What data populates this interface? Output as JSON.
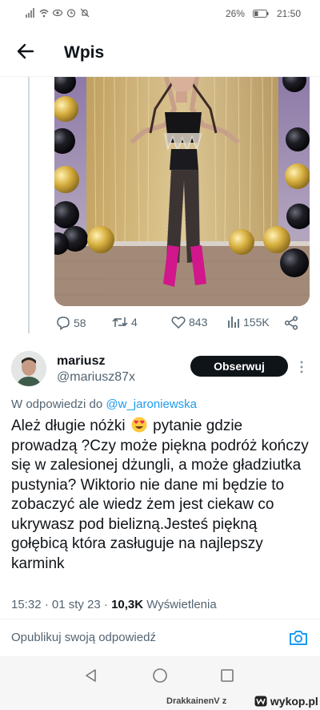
{
  "status_bar": {
    "battery": "26%",
    "time": "21:50"
  },
  "header": {
    "title": "Wpis"
  },
  "parent_tweet": {
    "media_alt_icon": "photo",
    "stats": {
      "replies": "58",
      "retweets": "4",
      "likes": "843",
      "views": "155K"
    }
  },
  "reply": {
    "author_name": "mariusz",
    "author_handle": "@mariusz87x",
    "follow_label": "Obserwuj",
    "reply_to_prefix": "W odpowiedzi do",
    "reply_to_handle": "@w_jaroniewska",
    "text_before_emoji": "Ależ długie nóżki",
    "text_after_emoji": "pytanie gdzie prowadzą ?Czy może piękna podróż kończy się w zalesionej dżungli, a może gładziutka pustynia? Wiktorio nie dane mi będzie to zobaczyć ale wiedz żem jest ciekaw co ukrywasz pod bielizną.Jesteś piękną gołębicą która zasługuje na najlepszy karmink",
    "emoji": "heart-eyes-emoji",
    "timestamp": "15:32 · 01 sty 23 · ",
    "views_count": "10,3K",
    "views_label": "Wyświetlenia"
  },
  "compose": {
    "placeholder": "Opublikuj swoją odpowiedź"
  },
  "watermark": {
    "user": "DrakkainenV z",
    "site": "wykop.pl"
  },
  "colors": {
    "accent": "#1d9bf0",
    "text": "#0f1419",
    "secondary": "#536471"
  }
}
